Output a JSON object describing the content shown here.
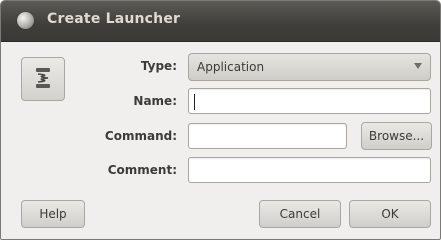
{
  "window": {
    "title": "Create Launcher"
  },
  "form": {
    "type_label": "Type:",
    "type_value": "Application",
    "name_label": "Name:",
    "name_value": "",
    "command_label": "Command:",
    "command_value": "",
    "browse_label": "Browse...",
    "comment_label": "Comment:",
    "comment_value": ""
  },
  "buttons": {
    "help": "Help",
    "cancel": "Cancel",
    "ok": "OK"
  },
  "icons": {
    "title_icon": "window-menu-icon",
    "launcher_icon": "spring-launcher-icon",
    "combo_arrow": "chevron-down-icon"
  },
  "colors": {
    "titlebar": "#3f3e3a",
    "title_text": "#dfdbd2",
    "dialog_bg": "#f0efed"
  }
}
